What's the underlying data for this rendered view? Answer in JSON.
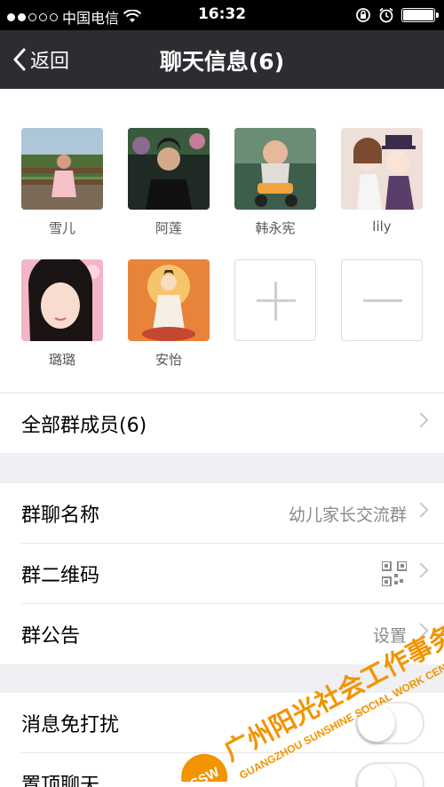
{
  "status_bar": {
    "carrier": "中国电信",
    "time": "16:32"
  },
  "nav": {
    "back_label": "返回",
    "title": "聊天信息(6)"
  },
  "members": [
    {
      "name": "雪儿",
      "icon": "girl-garden-photo"
    },
    {
      "name": "阿莲",
      "icon": "woman-portrait-photo"
    },
    {
      "name": "韩永宪",
      "icon": "toddler-bike-photo"
    },
    {
      "name": "lily",
      "icon": "anime-couple-photo"
    },
    {
      "name": "璐璐",
      "icon": "girl-selfie-photo"
    },
    {
      "name": "安怡",
      "icon": "guanyin-painting"
    }
  ],
  "rows": {
    "all_members": "全部群成员(6)",
    "group_name_label": "群聊名称",
    "group_name_value": "幼儿家长交流群",
    "qr_label": "群二维码",
    "notice_label": "群公告",
    "notice_value": "设置",
    "mute_label": "消息免打扰",
    "pin_label": "置顶聊天"
  },
  "toggles": {
    "mute_on": false,
    "pin_on": false
  },
  "watermark": {
    "cn": "广州阳光社会工作事务中心",
    "en": "GUANGZHOU SUNSHINE SOCIAL WORK CENTER",
    "logo": "SSW"
  },
  "colors": {
    "nav_bg": "#2d2d31",
    "group_bg": "#efeff4",
    "watermark_orange": "#f29400"
  }
}
